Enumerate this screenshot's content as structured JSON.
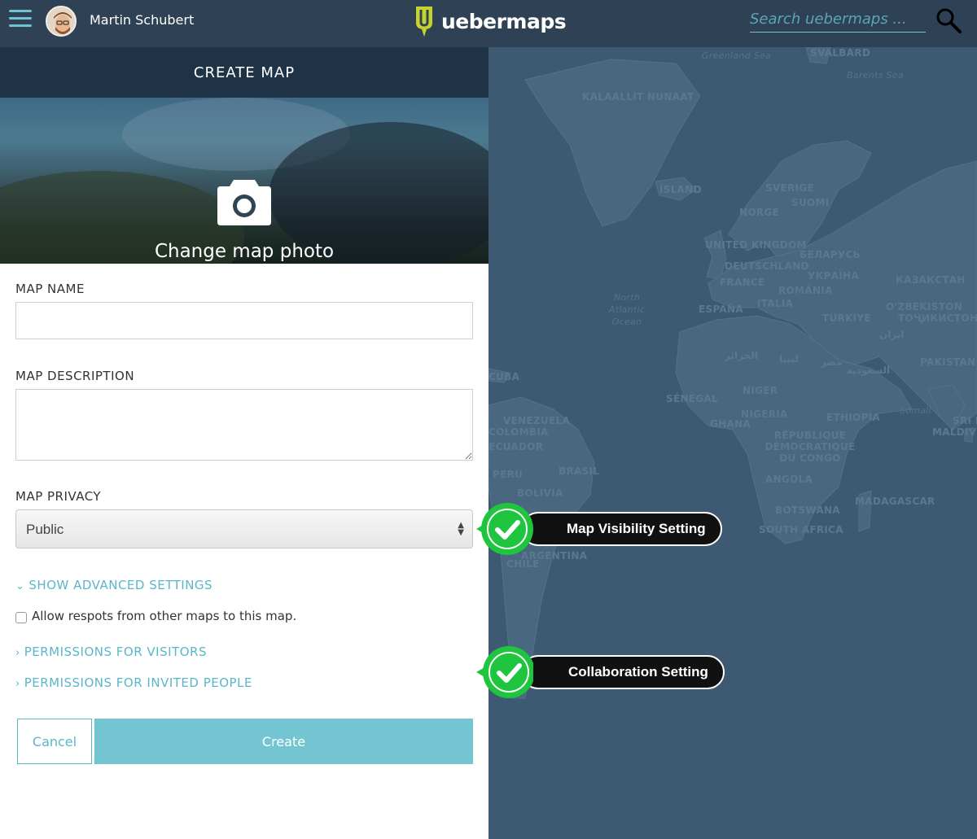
{
  "header": {
    "user_name": "Martin Schubert",
    "logo_text": "uebermaps",
    "search_placeholder": "Search uebermaps ...",
    "icons": [
      "hamburger-menu-icon",
      "avatar",
      "uebermaps-logo-icon",
      "search-icon"
    ]
  },
  "panel": {
    "title": "CREATE MAP",
    "change_photo_label": "Change map photo",
    "map_name_label": "MAP NAME",
    "map_name_value": "",
    "map_description_label": "MAP DESCRIPTION",
    "map_description_value": "",
    "map_privacy_label": "MAP PRIVACY",
    "map_privacy_value": "Public",
    "show_advanced": "SHOW ADVANCED SETTINGS",
    "allow_respots": "Allow respots from other maps to this map.",
    "allow_respots_checked": false,
    "permissions_visitors": "PERMISSIONS FOR VISITORS",
    "permissions_invited": "PERMISSIONS FOR INVITED PEOPLE",
    "cancel_label": "Cancel",
    "create_label": "Create"
  },
  "callouts": [
    {
      "label": "Map Visibility Setting",
      "color": "#1fc43f"
    },
    {
      "label": "Collaboration Setting",
      "color": "#1fc43f"
    }
  ],
  "map": {
    "labels": [
      "SVALBARD",
      "Greenland Sea",
      "Barents Sea",
      "KALAALLIT NUNAAT",
      "ÍSLAND",
      "SVERIGE",
      "SUOMI",
      "NORGE",
      "UNITED KINGDOM",
      "DEUTSCHLAND",
      "БЕЛАРУСЬ",
      "УКРАЇНА",
      "FRANCE",
      "ROMÂNIA",
      "ESPAÑA",
      "ITALIA",
      "TÜRKIYE",
      "КАЗАКСТАН",
      "O'ZBEKISTON",
      "ТОҶИКИСТОН",
      "ایران",
      "PAKISTAN",
      "North Atlantic Ocean",
      "الجزائر",
      "ليبيا",
      "مصر",
      "السعودية",
      "CUBA",
      "SÉNÉGAL",
      "NIGER",
      "NIGERIA",
      "GHANA",
      "ETHIOPIA",
      "Somali",
      "VENEZUELA",
      "COLOMBIA",
      "ECUADOR",
      "RÉPUBLIQUE DÉMOCRATIQUE DU CONGO",
      "PERÚ",
      "BRASIL",
      "BOLIVIA",
      "ANGOLA",
      "MADAGASCAR",
      "BOTSWANA",
      "SOUTH AFRICA",
      "ARGENTINA",
      "CHILE",
      "SRI LA",
      "MALDIVES"
    ]
  }
}
